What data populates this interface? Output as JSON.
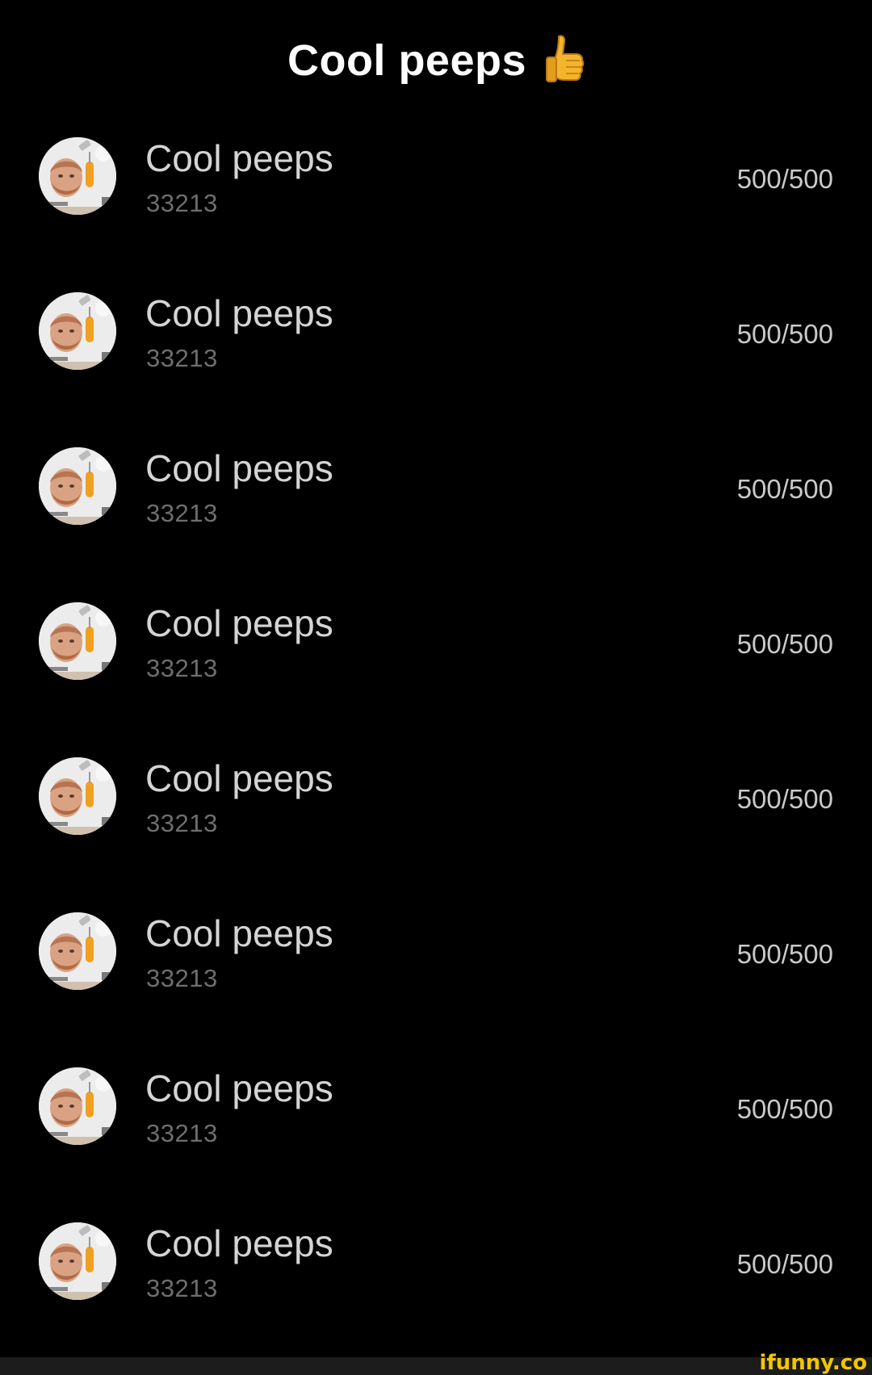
{
  "header": {
    "title": "Cool peeps",
    "emoji_icon": "thumbs-up-icon"
  },
  "groups": [
    {
      "name": "Cool peeps",
      "id": "33213",
      "count": "500/500"
    },
    {
      "name": "Cool peeps",
      "id": "33213",
      "count": "500/500"
    },
    {
      "name": "Cool peeps",
      "id": "33213",
      "count": "500/500"
    },
    {
      "name": "Cool peeps",
      "id": "33213",
      "count": "500/500"
    },
    {
      "name": "Cool peeps",
      "id": "33213",
      "count": "500/500"
    },
    {
      "name": "Cool peeps",
      "id": "33213",
      "count": "500/500"
    },
    {
      "name": "Cool peeps",
      "id": "33213",
      "count": "500/500"
    },
    {
      "name": "Cool peeps",
      "id": "33213",
      "count": "500/500"
    }
  ],
  "watermark": "ifunny.co",
  "colors": {
    "background": "#000000",
    "name_text": "#d4d4d4",
    "id_text": "#6e6e6e",
    "count_text": "#c9c9c9",
    "watermark": "#f2c500"
  }
}
